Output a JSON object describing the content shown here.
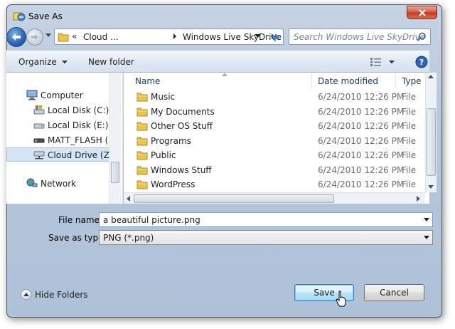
{
  "window": {
    "title": "Save As"
  },
  "address": {
    "overflow": "«",
    "segments": [
      "Cloud ...",
      "Windows Live SkyDrive"
    ]
  },
  "search": {
    "placeholder": "Search Windows Live SkyDrive"
  },
  "toolbar": {
    "organize": "Organize",
    "new_folder": "New folder"
  },
  "nav_pane": {
    "items": [
      {
        "label": "Computer",
        "icon": "computer-icon"
      },
      {
        "label": "Local Disk (C:)",
        "icon": "windows-drive-icon"
      },
      {
        "label": "Local Disk (E:)",
        "icon": "drive-icon"
      },
      {
        "label": "MATT_FLASH (G",
        "icon": "usb-drive-icon"
      },
      {
        "label": "Cloud Drive (Z:)",
        "icon": "network-drive-icon",
        "selected": true
      },
      {
        "label": "Network",
        "icon": "network-icon"
      }
    ]
  },
  "columns": {
    "name": "Name",
    "date": "Date modified",
    "type": "Type"
  },
  "files": [
    {
      "name": "Music",
      "date": "6/24/2010 12:26 PM",
      "type": "File folder"
    },
    {
      "name": "My Documents",
      "date": "6/24/2010 12:26 PM",
      "type": "File folder"
    },
    {
      "name": "Other OS Stuff",
      "date": "6/24/2010 12:26 PM",
      "type": "File folder"
    },
    {
      "name": "Programs",
      "date": "6/24/2010 12:26 PM",
      "type": "File folder"
    },
    {
      "name": "Public",
      "date": "6/24/2010 12:26 PM",
      "type": "File folder"
    },
    {
      "name": "Windows Stuff",
      "date": "6/24/2010 12:26 PM",
      "type": "File folder"
    },
    {
      "name": "WordPress",
      "date": "6/24/2010 12:26 PM",
      "type": "File folder"
    }
  ],
  "form": {
    "file_name_label": "File name:",
    "file_name_value": "a beautiful picture.png",
    "save_type_label": "Save as type:",
    "save_type_value": "PNG (*.png)"
  },
  "footer": {
    "hide_folders": "Hide Folders",
    "save": "Save",
    "cancel": "Cancel"
  },
  "colors": {
    "folder": "#e8c44f",
    "accent": "#3c7fb1",
    "selection": "#d6e5f5"
  }
}
